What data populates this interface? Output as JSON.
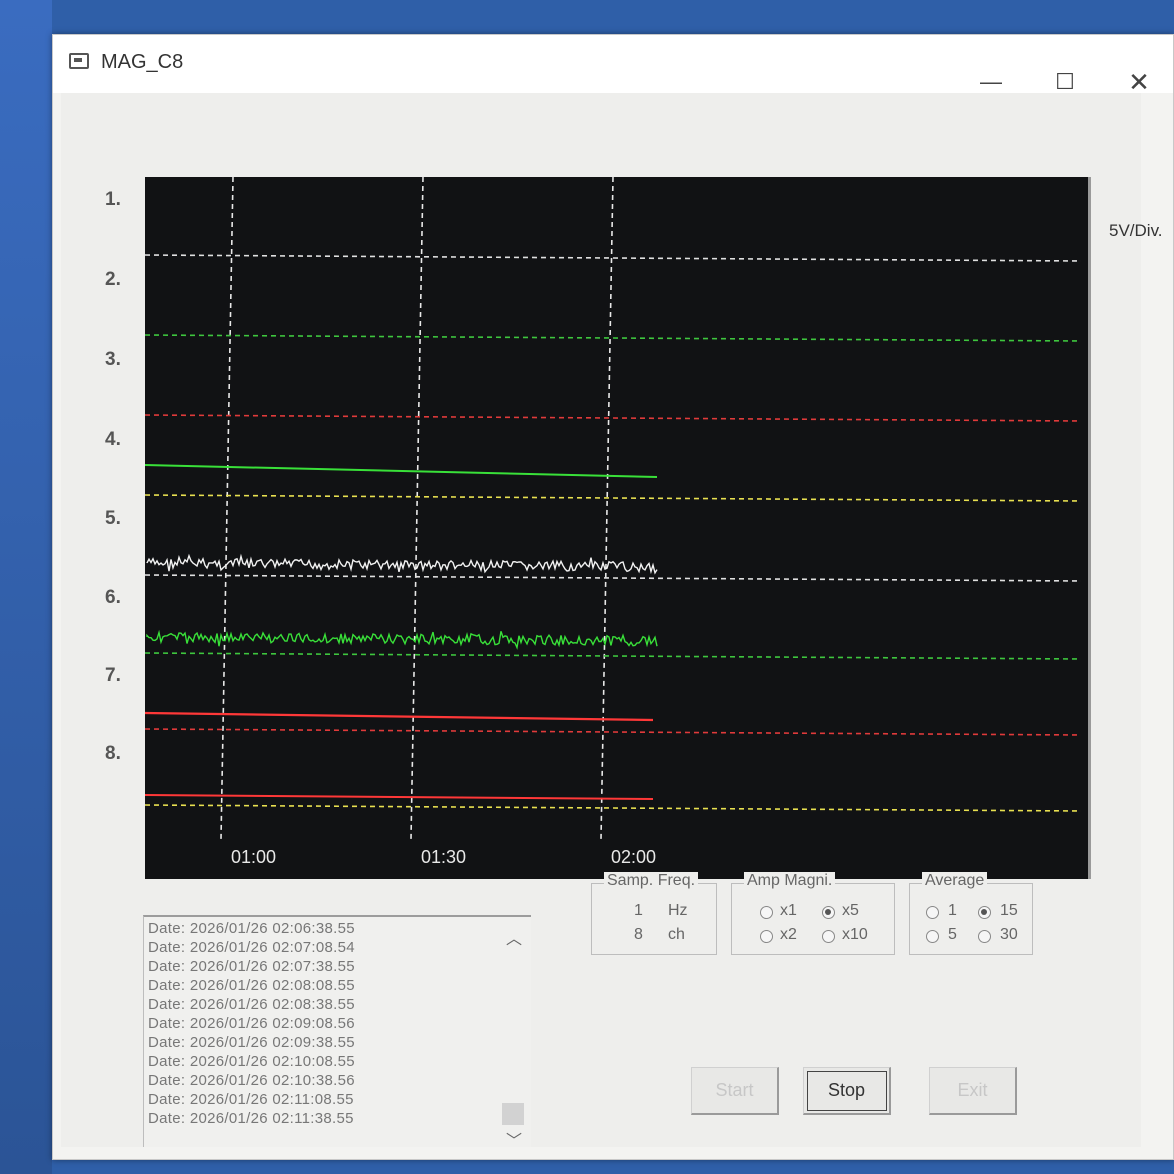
{
  "window": {
    "title": "MAG_C8",
    "minimize": "—",
    "maximize": "☐",
    "close": "✕"
  },
  "plot": {
    "unit": "5V/Div.",
    "channels": [
      "1.",
      "2.",
      "3.",
      "4.",
      "5.",
      "6.",
      "7.",
      "8."
    ],
    "time_labels": [
      "01:00",
      "01:30",
      "02:00"
    ],
    "baseline_colors": [
      "#e0e0e0",
      "#3ec63e",
      "#e03a3a",
      "#e8e050",
      "#e0e0e0",
      "#3ec63e",
      "#e03a3a",
      "#e8e050"
    ],
    "traces": [
      {
        "channel": "4.",
        "color": "#39e039",
        "style": "flat"
      },
      {
        "channel": "5.",
        "color": "#f2f2f2",
        "style": "noise"
      },
      {
        "channel": "6.",
        "color": "#39e039",
        "style": "noise"
      },
      {
        "channel": "7.",
        "color": "#ff3838",
        "style": "flat"
      },
      {
        "channel": "8.",
        "color": "#ff3838",
        "style": "flat"
      }
    ]
  },
  "log": {
    "lines": [
      "Date: 2026/01/26 02:06:38.55",
      "Date: 2026/01/26 02:07:08.54",
      "Date: 2026/01/26 02:07:38.55",
      "Date: 2026/01/26 02:08:08.55",
      "Date: 2026/01/26 02:08:38.55",
      "Date: 2026/01/26 02:09:08.56",
      "Date: 2026/01/26 02:09:38.55",
      "Date: 2026/01/26 02:10:08.55",
      "Date: 2026/01/26 02:10:38.56",
      "Date: 2026/01/26 02:11:08.55",
      "Date: 2026/01/26 02:11:38.55"
    ]
  },
  "samp_freq": {
    "title": "Samp. Freq.",
    "freq_value": "1",
    "freq_unit": "Hz",
    "ch_value": "8",
    "ch_unit": "ch"
  },
  "amp_magni": {
    "title": "Amp Magni.",
    "options": [
      "x1",
      "x5",
      "x2",
      "x10"
    ],
    "selected": "x5"
  },
  "average": {
    "title": "Average",
    "options": [
      "1",
      "15",
      "5",
      "30"
    ],
    "selected": "15"
  },
  "buttons": {
    "start": "Start",
    "stop": "Stop",
    "exit": "Exit"
  }
}
